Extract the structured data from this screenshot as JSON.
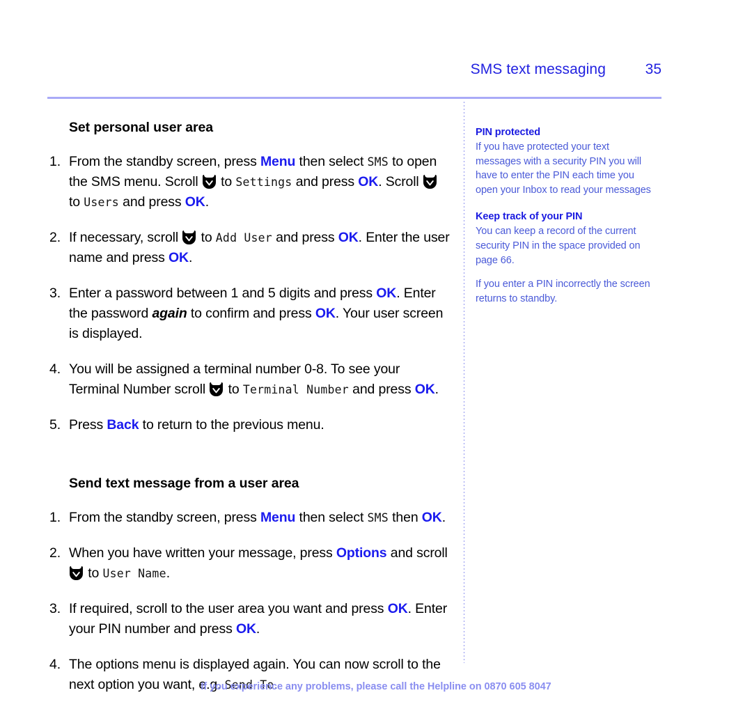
{
  "header": {
    "title": "SMS text messaging",
    "page_number": "35",
    "title_color": "#2222e0"
  },
  "main": {
    "sections": [
      {
        "heading": "Set personal user area",
        "steps": [
          {
            "num": "1.",
            "parts": [
              {
                "t": "From the standby screen, press ",
                "k": "plain"
              },
              {
                "t": "Menu",
                "k": "kw"
              },
              {
                "t": " then select ",
                "k": "plain"
              },
              {
                "t": "SMS",
                "k": "lcd"
              },
              {
                "t": " to open the SMS menu. Scroll ",
                "k": "plain"
              },
              {
                "t": "scroll-down-icon",
                "k": "icon"
              },
              {
                "t": " to ",
                "k": "plain"
              },
              {
                "t": "Settings",
                "k": "lcd"
              },
              {
                "t": " and press ",
                "k": "plain"
              },
              {
                "t": "OK",
                "k": "kw"
              },
              {
                "t": ". Scroll ",
                "k": "plain"
              },
              {
                "t": "scroll-down-icon",
                "k": "icon"
              },
              {
                "t": " to ",
                "k": "plain"
              },
              {
                "t": "Users",
                "k": "lcd"
              },
              {
                "t": " and press ",
                "k": "plain"
              },
              {
                "t": "OK",
                "k": "kw"
              },
              {
                "t": ".",
                "k": "plain"
              }
            ]
          },
          {
            "num": "2.",
            "parts": [
              {
                "t": "If necessary, scroll ",
                "k": "plain"
              },
              {
                "t": "scroll-down-icon",
                "k": "icon"
              },
              {
                "t": " to ",
                "k": "plain"
              },
              {
                "t": "Add User",
                "k": "lcd"
              },
              {
                "t": " and press ",
                "k": "plain"
              },
              {
                "t": "OK",
                "k": "kw"
              },
              {
                "t": ". Enter the user name and press ",
                "k": "plain"
              },
              {
                "t": "OK",
                "k": "kw"
              },
              {
                "t": ".",
                "k": "plain"
              }
            ]
          },
          {
            "num": "3.",
            "parts": [
              {
                "t": "Enter a password between 1 and 5 digits and press ",
                "k": "plain"
              },
              {
                "t": "OK",
                "k": "kw"
              },
              {
                "t": ". Enter the password ",
                "k": "plain"
              },
              {
                "t": "again",
                "k": "italic"
              },
              {
                "t": " to confirm and press ",
                "k": "plain"
              },
              {
                "t": "OK",
                "k": "kw"
              },
              {
                "t": ". Your user screen is displayed.",
                "k": "plain"
              }
            ]
          },
          {
            "num": "4.",
            "parts": [
              {
                "t": "You will be assigned a terminal number 0-8. To see your Terminal Number scroll ",
                "k": "plain"
              },
              {
                "t": "scroll-down-icon",
                "k": "icon"
              },
              {
                "t": " to ",
                "k": "plain"
              },
              {
                "t": "Terminal Number",
                "k": "lcd"
              },
              {
                "t": " and press ",
                "k": "plain"
              },
              {
                "t": "OK",
                "k": "kw"
              },
              {
                "t": ".",
                "k": "plain"
              }
            ]
          },
          {
            "num": "5.",
            "parts": [
              {
                "t": "Press ",
                "k": "plain"
              },
              {
                "t": "Back",
                "k": "kw"
              },
              {
                "t": " to return to the previous menu.",
                "k": "plain"
              }
            ]
          }
        ]
      },
      {
        "heading": "Send text message from a user area",
        "steps": [
          {
            "num": "1.",
            "parts": [
              {
                "t": "From the standby screen, press ",
                "k": "plain"
              },
              {
                "t": "Menu",
                "k": "kw"
              },
              {
                "t": " then select ",
                "k": "plain"
              },
              {
                "t": "SMS",
                "k": "lcd"
              },
              {
                "t": " then ",
                "k": "plain"
              },
              {
                "t": "OK",
                "k": "kw"
              },
              {
                "t": ".",
                "k": "plain"
              }
            ]
          },
          {
            "num": "2.",
            "parts": [
              {
                "t": "When you have written your message, press ",
                "k": "plain"
              },
              {
                "t": "Options",
                "k": "kw"
              },
              {
                "t": " and scroll ",
                "k": "plain"
              },
              {
                "t": "scroll-down-icon",
                "k": "icon"
              },
              {
                "t": " to ",
                "k": "plain"
              },
              {
                "t": "User Name",
                "k": "lcd"
              },
              {
                "t": ".",
                "k": "plain"
              }
            ]
          },
          {
            "num": "3.",
            "parts": [
              {
                "t": "If required, scroll to the user area you want and press ",
                "k": "plain"
              },
              {
                "t": "OK",
                "k": "kw"
              },
              {
                "t": ". Enter your PIN number and press ",
                "k": "plain"
              },
              {
                "t": "OK",
                "k": "kw"
              },
              {
                "t": ".",
                "k": "plain"
              }
            ]
          },
          {
            "num": "4.",
            "parts": [
              {
                "t": "The options menu is displayed again. You can now scroll to the next option you want, e.g. ",
                "k": "plain"
              },
              {
                "t": "Send To",
                "k": "lcd"
              },
              {
                "t": ".",
                "k": "plain"
              }
            ]
          }
        ]
      }
    ]
  },
  "sidebar": {
    "blocks": [
      {
        "heading": "PIN protected",
        "paragraphs": [
          "If you have protected your text messages with a security PIN you will have to enter the PIN each time you open your Inbox to read your messages"
        ]
      },
      {
        "heading": "Keep track of your PIN",
        "paragraphs": [
          "You can keep a record of the current security PIN in the space provided on page 66.",
          "If you enter a PIN incorrectly the screen returns to standby."
        ]
      }
    ]
  },
  "footer": {
    "text": "If you experience any problems, please call the Helpline on ",
    "phone": "0870 605 8047"
  },
  "colors": {
    "accent_blue": "#1a1aee",
    "header_blue": "#2222e0",
    "sidebar_body": "#4a5ad8",
    "rule": "#a9aaf7",
    "footer": "#8a8ef0"
  }
}
